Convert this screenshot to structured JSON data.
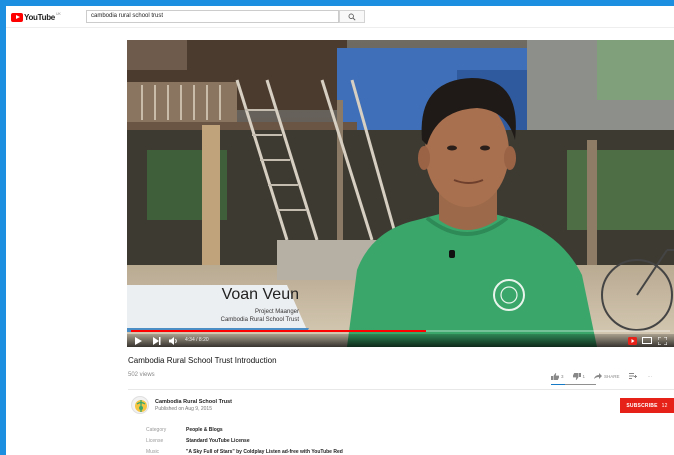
{
  "masthead": {
    "logo_text": "YouTube",
    "logo_superscript": "UK",
    "search_value": "cambodia rural school trust",
    "search_icon": "search-icon"
  },
  "player": {
    "overlay_name": "Voan Veun",
    "overlay_role": "Project Maanger",
    "overlay_org": "Cambodia Rural School Trust",
    "time_text": "4:34 / 8:20",
    "progress_fraction": 0.548,
    "progress_color": "#ff0000"
  },
  "video": {
    "title": "Cambodia Rural School Trust Introduction",
    "views": "502 views",
    "likes": "3",
    "dislikes": "1",
    "share_label": "SHARE",
    "more_label": "···"
  },
  "channel": {
    "name": "Cambodia Rural School Trust",
    "published": "Published on Aug 9, 2015",
    "subscribe_label": "SUBSCRIBE",
    "subscriber_count": "12",
    "subscribe_color": "#e62117"
  },
  "metadata": [
    {
      "label": "Category",
      "value": "People & Blogs"
    },
    {
      "label": "License",
      "value": "Standard YouTube License"
    },
    {
      "label": "Music",
      "value": "\"A Sky Full of Stars\" by Coldplay  Listen ad-free with YouTube Red"
    }
  ]
}
